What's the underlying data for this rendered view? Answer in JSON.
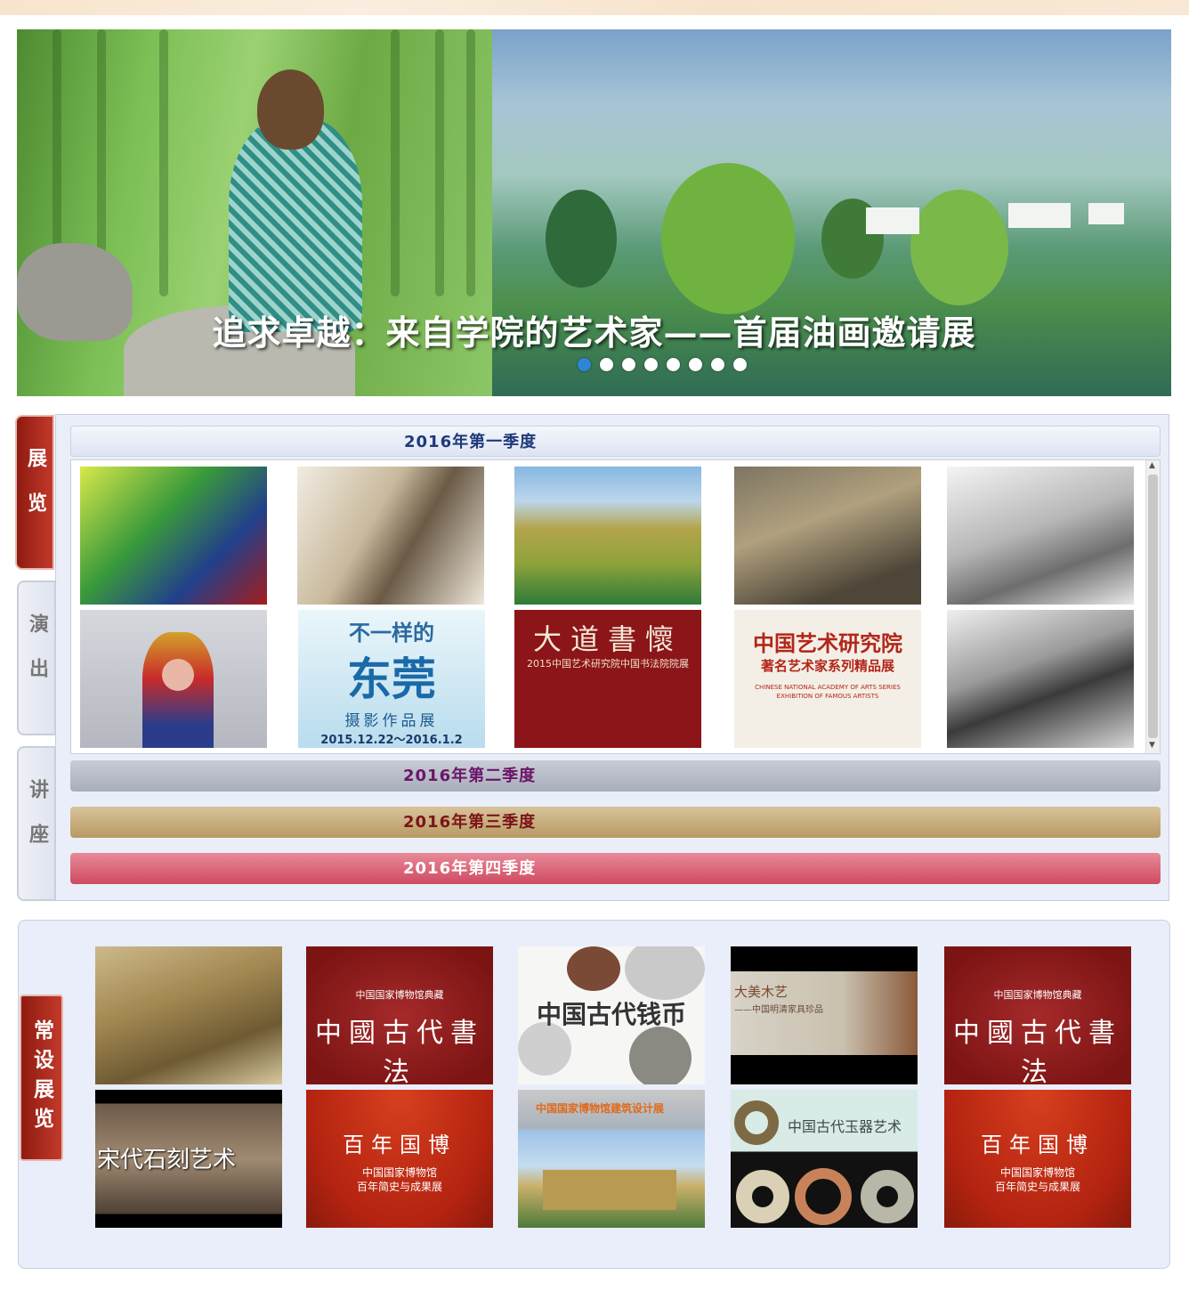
{
  "banner": {
    "title": "追求卓越：来自学院的艺术家——首届油画邀请展",
    "slide_count": 8,
    "active_index": 0
  },
  "side_tabs": [
    "展览",
    "演出",
    "讲座"
  ],
  "seasons": [
    "2016年第一季度",
    "2016年第二季度",
    "2016年第三季度",
    "2016年第四季度"
  ],
  "exhibitions": {
    "row2": {
      "dongguan": {
        "line1": "不一样的",
        "line2": "东莞",
        "line3": "摄影作品展",
        "dates": "2015.12.22～2016.1.2"
      },
      "calligraphy": {
        "title": "大道書懷",
        "subtitle": "2015中国艺术研究院中国书法院院展"
      },
      "famous": {
        "title": "中国艺术研究院",
        "subtitle": "著名艺术家系列精品展",
        "en": "CHINESE NATIONAL ACADEMY OF ARTS SERIES EXHIBITION OF FAMOUS ARTISTS"
      }
    }
  },
  "permanent": {
    "tab_label": "常设展览",
    "cards": {
      "calligraphy_a": {
        "top": "中国国家博物馆典藏",
        "main": "中國古代書法"
      },
      "coins": {
        "main": "中国古代钱币"
      },
      "furniture": {
        "main": "大美木艺",
        "sub": "——中国明清家具珍品"
      },
      "calligraphy_b": {
        "top": "中国国家博物馆典藏",
        "main": "中國古代書法"
      },
      "stone": {
        "main": "宋代石刻艺术"
      },
      "century_a": {
        "main": "百年国博",
        "sub1": "中国国家博物馆",
        "sub2": "百年简史与成果展"
      },
      "architecture": {
        "main": "中国国家博物馆建筑设计展"
      },
      "jade": {
        "main": "中国古代玉器艺术"
      },
      "century_b": {
        "main": "百年国博",
        "sub1": "中国国家博物馆",
        "sub2": "百年简史与成果展"
      }
    }
  },
  "colors": {
    "tab_red": "#a8291c",
    "season1": "#1f3a7a",
    "season2": "#6b1568",
    "season3": "#7b1419",
    "dot_active": "#2d86d6"
  }
}
